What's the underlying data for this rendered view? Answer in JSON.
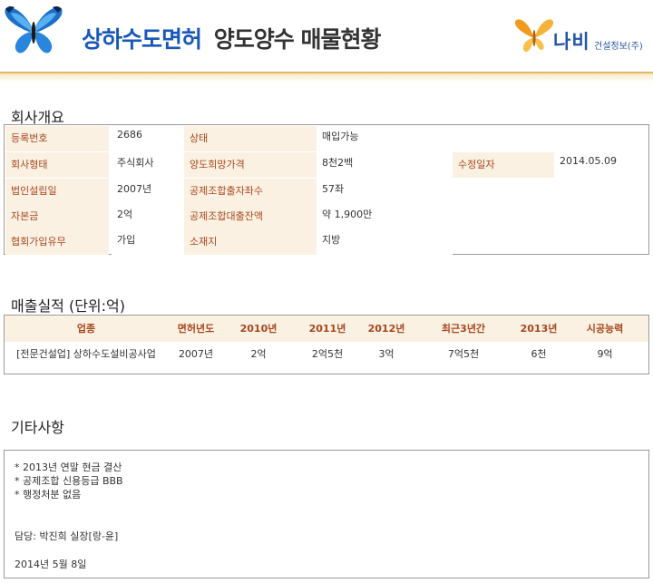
{
  "header": {
    "title_blue": "상하수도면허",
    "title_dark": "양도양수 매물현황",
    "logo_main": "나비",
    "logo_sub": "건설정보(주)"
  },
  "company": {
    "section_title": "회사개요",
    "rows": [
      [
        {
          "label": "등록번호",
          "value": "2686"
        },
        {
          "label": "상태",
          "value": "매입가능"
        }
      ],
      [
        {
          "label": "회사형태",
          "value": "주식회사"
        },
        {
          "label": "양도희망가격",
          "value": "8천2백"
        },
        {
          "label": "수정일자",
          "value": "2014.05.09"
        }
      ],
      [
        {
          "label": "법인설립일",
          "value": "2007년"
        },
        {
          "label": "공제조합출자좌수",
          "value": "57좌"
        }
      ],
      [
        {
          "label": "자본금",
          "value": "2억"
        },
        {
          "label": "공제조합대출잔액",
          "value": "약 1,900만"
        }
      ],
      [
        {
          "label": "협회가입유무",
          "value": "가입"
        },
        {
          "label": "소재지",
          "value": "지방"
        }
      ]
    ]
  },
  "sales": {
    "section_title": "매출실적 (단위:억)",
    "headers": [
      "업종",
      "면허년도",
      "2010년",
      "2011년",
      "2012년",
      "최근3년간",
      "2013년",
      "시공능력"
    ],
    "row": [
      "[전문건설업] 상하수도설비공사업",
      "2007년",
      "2억",
      "2억5천",
      "3억",
      "7억5천",
      "6천",
      "9억"
    ]
  },
  "notes": {
    "section_title": "기타사항",
    "lines": [
      "* 2013년 연말 현금 결산",
      "* 공제조합 신용등급 BBB",
      "* 행정처분 없음",
      "",
      "담당: 박진희 실장[랑-윤]",
      "2014년 5월 8일"
    ]
  },
  "colors": {
    "title_blue": "#1a58b8",
    "label_text": "#a8461d",
    "label_bg": "#fbf1e3",
    "accent_line": "#e3b66b"
  }
}
